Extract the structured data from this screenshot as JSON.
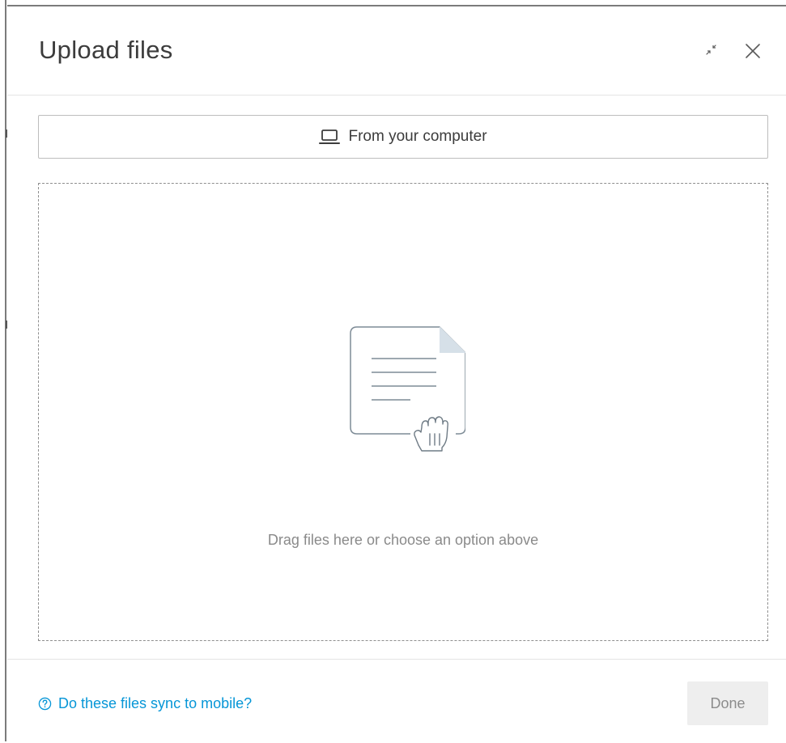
{
  "dialog": {
    "title": "Upload files",
    "minimize_icon": "minimize-arrows-icon",
    "close_icon": "close-icon"
  },
  "source_button": {
    "icon": "laptop-icon",
    "label": "From your computer"
  },
  "dropzone": {
    "illustration": "document-drag-hand-icon",
    "text": "Drag files here or choose an option above"
  },
  "footer": {
    "help_icon": "question-circle-icon",
    "help_link": "Do these files sync to mobile?",
    "done_label": "Done",
    "done_enabled": false
  },
  "colors": {
    "link": "#0696d7",
    "illustration_fill": "#d6e0e8",
    "illustration_stroke": "#7d8b96"
  }
}
